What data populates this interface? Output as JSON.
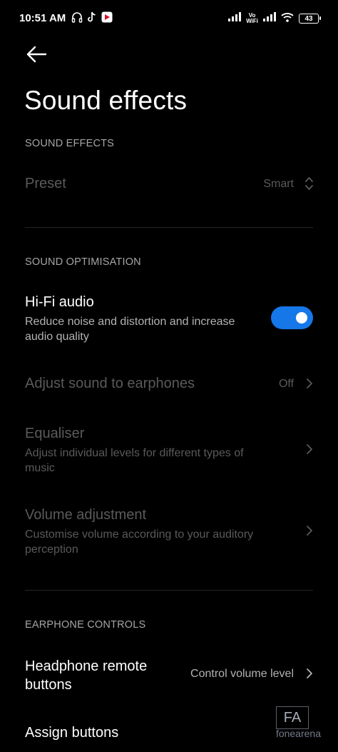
{
  "status_bar": {
    "time": "10:51 AM",
    "battery": "43",
    "vowifi_top": "Vo",
    "vowifi_bottom": "WiFi"
  },
  "header": {
    "title": "Sound effects"
  },
  "sections": {
    "sound_effects": "SOUND EFFECTS",
    "sound_optimisation": "SOUND OPTIMISATION",
    "earphone_controls": "EARPHONE CONTROLS"
  },
  "preset": {
    "label": "Preset",
    "value": "Smart"
  },
  "hifi": {
    "label": "Hi-Fi audio",
    "description": "Reduce noise and distortion and increase audio quality",
    "enabled": true
  },
  "adjust_earphones": {
    "label": "Adjust sound to earphones",
    "value": "Off"
  },
  "equaliser": {
    "label": "Equaliser",
    "description": "Adjust individual levels for different types of music"
  },
  "volume_adjustment": {
    "label": "Volume adjustment",
    "description": "Customise volume according to your auditory perception"
  },
  "headphone_remote": {
    "label": "Headphone remote buttons",
    "value": "Control volume level"
  },
  "assign_buttons": {
    "label": "Assign buttons"
  },
  "watermark": {
    "box": "FA",
    "text": "fonearena"
  },
  "colors": {
    "background": "#000000",
    "accent": "#1677e8",
    "disabled": "#5a5a5a"
  }
}
